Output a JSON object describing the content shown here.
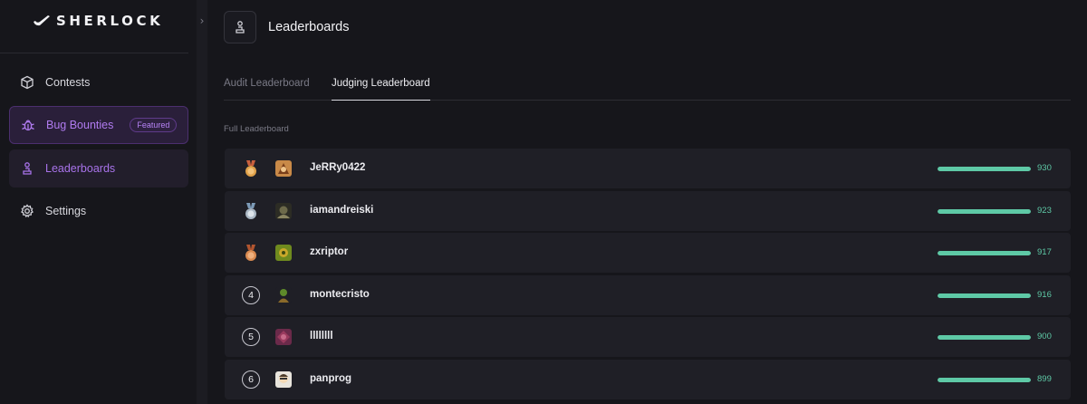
{
  "brand": {
    "name": "SHERLOCK"
  },
  "sidebar": {
    "items": [
      {
        "label": "Contests",
        "icon": "cube-icon"
      },
      {
        "label": "Bug Bounties",
        "icon": "bug-icon",
        "badge": "Featured"
      },
      {
        "label": "Leaderboards",
        "icon": "podium-icon"
      },
      {
        "label": "Settings",
        "icon": "gear-icon"
      }
    ]
  },
  "header": {
    "title": "Leaderboards"
  },
  "tabs": [
    {
      "label": "Audit Leaderboard"
    },
    {
      "label": "Judging Leaderboard"
    }
  ],
  "section": {
    "label": "Full Leaderboard"
  },
  "colors": {
    "accent_purple": "#a873ea",
    "score_green": "#5ec9a6",
    "gold": "#e0a14a",
    "silver": "#aab7c4"
  },
  "leaderboard": [
    {
      "rank": "1",
      "rank_icon": "gold-medal-icon",
      "avatar": "avatar-icon",
      "username": "JeRRy0422",
      "score": "930",
      "score_fraction": 1.0
    },
    {
      "rank": "2",
      "rank_icon": "silver-medal-icon",
      "avatar": "avatar-icon",
      "username": "iamandreiski",
      "score": "923",
      "score_fraction": 1.0
    },
    {
      "rank": "3",
      "rank_icon": "bronze-medal-icon",
      "avatar": "avatar-icon",
      "username": "zxriptor",
      "score": "917",
      "score_fraction": 1.0
    },
    {
      "rank": "4",
      "rank_icon": "",
      "avatar": "avatar-icon",
      "username": "montecristo",
      "score": "916",
      "score_fraction": 1.0
    },
    {
      "rank": "5",
      "rank_icon": "",
      "avatar": "avatar-icon",
      "username": "llllllll",
      "score": "900",
      "score_fraction": 1.0
    },
    {
      "rank": "6",
      "rank_icon": "",
      "avatar": "avatar-icon",
      "username": "panprog",
      "score": "899",
      "score_fraction": 1.0
    }
  ]
}
